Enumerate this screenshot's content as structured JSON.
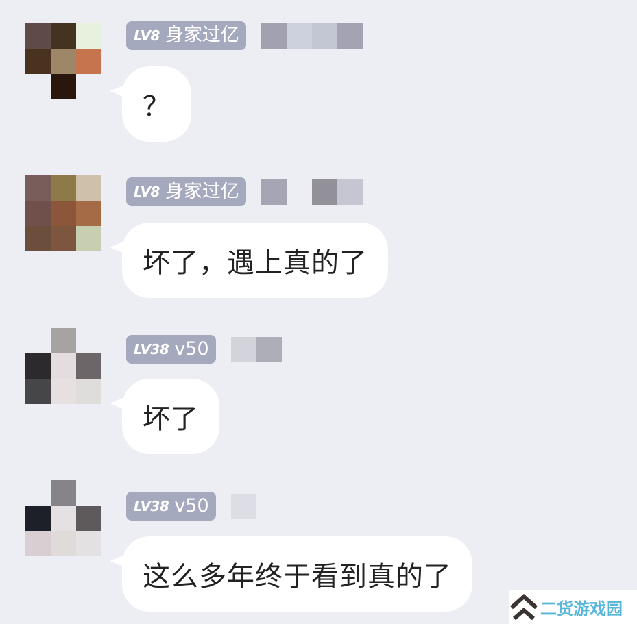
{
  "messages": [
    {
      "level": "LV8",
      "title": "身家过亿",
      "text": "？",
      "avatar_colors": [
        "#5f4a4a",
        "#453322",
        "#e8f1de",
        "#4a3221",
        "#9e8668",
        "#c5744d",
        "#ededf4",
        "#2b160d",
        "#ededf4"
      ],
      "name_blur_colors": [
        "#a1a1af",
        "#cdd0dd",
        "#c3c6d3",
        "#a3a3b3",
        "#ededf4"
      ]
    },
    {
      "level": "LV8",
      "title": "身家过亿",
      "text": "坏了，遇上真的了",
      "avatar_colors": [
        "#785e5b",
        "#8e7a48",
        "#cfc0ac",
        "#70504a",
        "#8c563b",
        "#a56b46",
        "#6c4e3c",
        "#7e5640",
        "#c8cfb1"
      ],
      "name_blur_colors": [
        "#a5a5b3",
        "#ededf4",
        "#929199",
        "#c6c6d2",
        "#ededf4"
      ]
    },
    {
      "level": "LV38",
      "title": "v50",
      "text": "坏了",
      "avatar_colors": [
        "#ededf4",
        "#a8a3a3",
        "#ededf4",
        "#2c2a2d",
        "#e4dcde",
        "#6c6669",
        "#464548",
        "#e6e0e0",
        "#dfdcdc"
      ],
      "name_blur_colors": [
        "#d3d3dc",
        "#aeaeb8",
        "#ededf4",
        "#ededf4",
        "#ededf4"
      ]
    },
    {
      "level": "LV38",
      "title": "v50",
      "text": "这么多年终于看到真的了",
      "avatar_colors": [
        "#ededf4",
        "#868489",
        "#ededf4",
        "#1d2029",
        "#e5e1e2",
        "#5e5a5c",
        "#d9cfd2",
        "#dfdbd9",
        "#e3e1e2"
      ],
      "name_blur_colors": [
        "#dddde5",
        "#ededf4",
        "#ededf4",
        "#ededf4",
        "#ededf4"
      ]
    }
  ],
  "watermark": {
    "text": "二货游戏园",
    "color": "#57b6d9",
    "logo_icon": "double-chevron-up-icon"
  }
}
